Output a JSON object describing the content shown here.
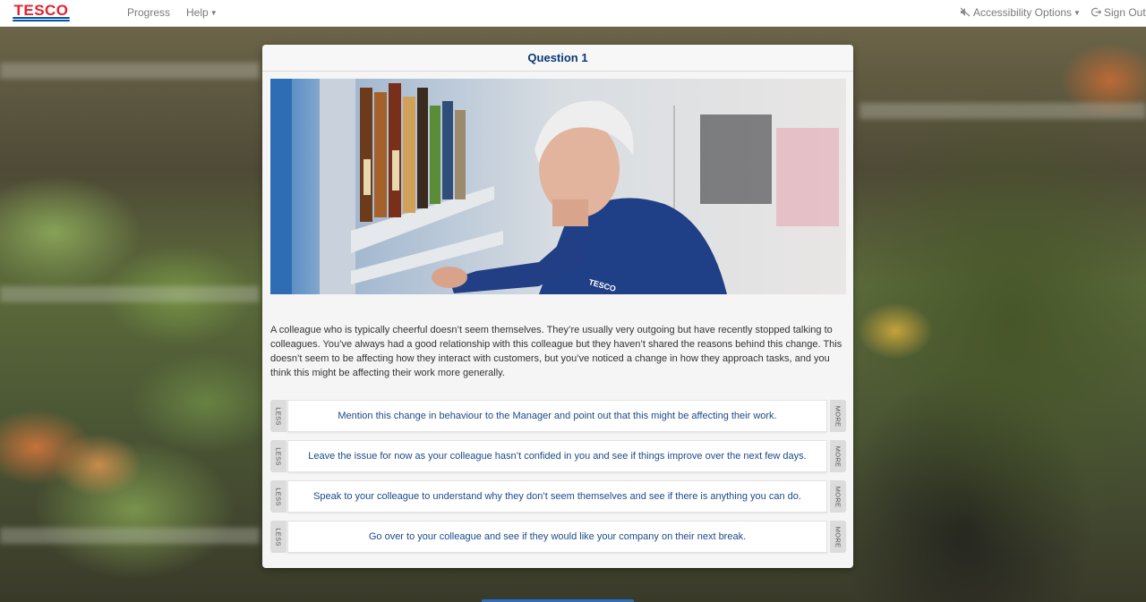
{
  "brand": {
    "logo_text": "TESCO"
  },
  "nav": {
    "progress": "Progress",
    "help": "Help",
    "accessibility": "Accessibility Options",
    "sign_out": "Sign Out"
  },
  "question": {
    "title": "Question 1",
    "scenario": "A colleague who is typically cheerful doesn’t seem themselves. They’re usually very outgoing but have recently stopped talking to colleagues. You’ve always had a good relationship with this colleague but they haven’t shared the reasons behind this change. This doesn’t seem to be affecting how they interact with customers, but you’ve noticed a change in how they approach tasks, and you think this might be affecting their work more generally.",
    "photo_badge": "TESCO",
    "less_label": "LESS",
    "more_label": "MORE",
    "options": [
      "Mention this change in behaviour to the Manager and point out that this might be affecting their work.",
      "Leave the issue for now as your colleague hasn’t confided in you and see if things improve over the next few days.",
      "Speak to your colleague to understand why they don’t seem themselves and see if there is anything you can do.",
      "Go over to your colleague and see if they would like your company on their next break."
    ]
  },
  "colors": {
    "brand_red": "#e5202e",
    "brand_blue": "#00539f",
    "title_blue": "#0a3a75",
    "option_text": "#1a4a8a"
  }
}
